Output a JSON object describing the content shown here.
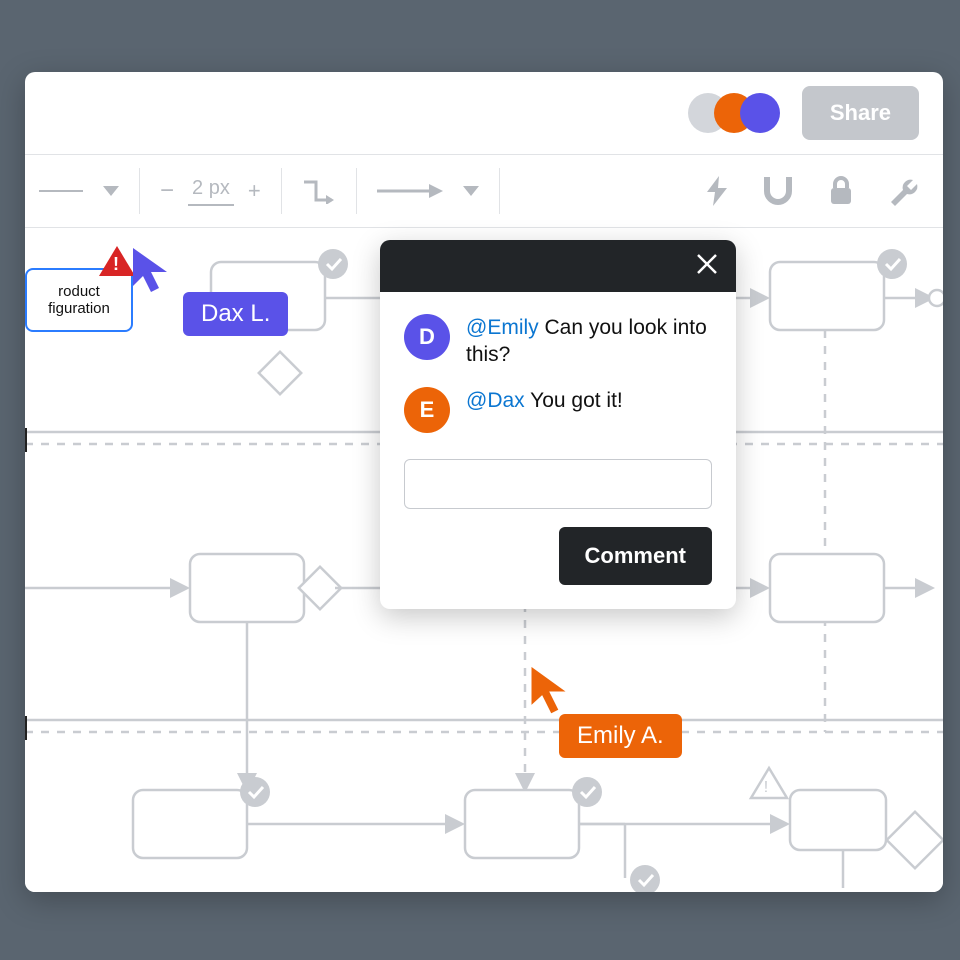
{
  "header": {
    "share_label": "Share",
    "presence_colors": [
      "#d3d6db",
      "#ec6408",
      "#5a52e8"
    ]
  },
  "toolbar": {
    "stroke_width": "2 px",
    "minus": "−",
    "plus": "+"
  },
  "canvas": {
    "selected_node_label": "roduct\nfiguration"
  },
  "cursors": {
    "dax": {
      "label": "Dax L.",
      "initial": "D"
    },
    "emily": {
      "label": "Emily A.",
      "initial": "E"
    }
  },
  "popup": {
    "comments": [
      {
        "avatar": "D",
        "mention": "@Emily",
        "text": " Can you look into this?"
      },
      {
        "avatar": "E",
        "mention": "@Dax",
        "text": " You got it!"
      }
    ],
    "input_placeholder": "",
    "submit_label": "Comment"
  }
}
